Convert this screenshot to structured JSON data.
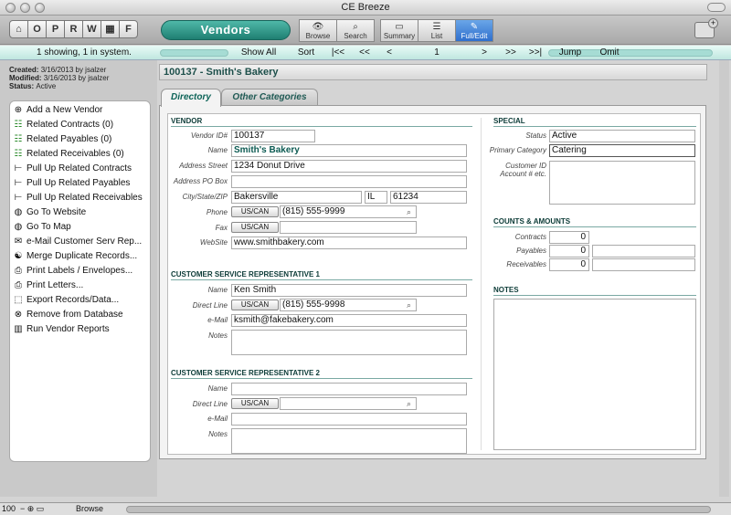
{
  "window": {
    "title": "CE Breeze"
  },
  "toolbar": {
    "home_icon": "home-icon",
    "letters": [
      "O",
      "P",
      "R",
      "W",
      "▦",
      "F"
    ],
    "module_label": "Vendors",
    "modes": [
      {
        "label": "Browse",
        "icon": "eye-icon",
        "glyph": "👁"
      },
      {
        "label": "Search",
        "icon": "magnifier-icon",
        "glyph": "⌕"
      },
      {
        "label": "Summary",
        "icon": "summary-icon",
        "glyph": "▭"
      },
      {
        "label": "List",
        "icon": "list-icon",
        "glyph": "☰"
      },
      {
        "label": "Full/Edit",
        "icon": "edit-icon",
        "glyph": "✎"
      }
    ]
  },
  "navbar": {
    "count_text": "1 showing, 1 in system.",
    "show_all": "Show All",
    "sort": "Sort",
    "first": "|<<",
    "prev_many": "<<",
    "prev": "<",
    "record_no": "1",
    "next": ">",
    "next_many": ">>",
    "last": ">>|",
    "jump": "Jump",
    "omit": "Omit"
  },
  "meta": {
    "created_label": "Created:",
    "created": "3/16/2013 by jsalzer",
    "modified_label": "Modified:",
    "modified": "3/16/2013 by jsalzer",
    "status_label": "Status:",
    "status": "Active"
  },
  "sidebar": {
    "items": [
      {
        "label": "Add a New Vendor",
        "icon": "plus-circle-icon",
        "glyph": "⊕"
      },
      {
        "label": "Related Contracts (0)",
        "icon": "list-icon",
        "glyph": "☷"
      },
      {
        "label": "Related Payables (0)",
        "icon": "list-icon",
        "glyph": "☷"
      },
      {
        "label": "Related Receivables (0)",
        "icon": "list-icon",
        "glyph": "☷"
      },
      {
        "label": "Pull Up Related Contracts",
        "icon": "tree-icon",
        "glyph": "⊢"
      },
      {
        "label": "Pull Up Related Payables",
        "icon": "tree-icon",
        "glyph": "⊢"
      },
      {
        "label": "Pull Up Related Receivables",
        "icon": "tree-icon",
        "glyph": "⊢"
      },
      {
        "label": "Go To Website",
        "icon": "globe-icon",
        "glyph": "◍"
      },
      {
        "label": "Go To Map",
        "icon": "globe-icon",
        "glyph": "◍"
      },
      {
        "label": "e-Mail Customer Serv Rep...",
        "icon": "envelope-icon",
        "glyph": "✉"
      },
      {
        "label": "Merge Duplicate Records...",
        "icon": "merge-icon",
        "glyph": "☯"
      },
      {
        "label": "Print Labels / Envelopes...",
        "icon": "printer-icon",
        "glyph": "⎙"
      },
      {
        "label": "Print Letters...",
        "icon": "printer-icon",
        "glyph": "⎙"
      },
      {
        "label": "Export Records/Data...",
        "icon": "export-icon",
        "glyph": "⬚"
      },
      {
        "label": "Remove from Database",
        "icon": "remove-icon",
        "glyph": "⊗"
      },
      {
        "label": "Run Vendor Reports",
        "icon": "chart-icon",
        "glyph": "▥"
      }
    ]
  },
  "record": {
    "header": "100137 - Smith's Bakery"
  },
  "tabs": [
    "Directory",
    "Other Categories"
  ],
  "vendor": {
    "section": "VENDOR",
    "id_label": "Vendor ID#",
    "id": "100137",
    "name_label": "Name",
    "name": "Smith's Bakery",
    "street_label": "Address Street",
    "street": "1234 Donut Drive",
    "pobox_label": "Address PO Box",
    "pobox": "",
    "csz_label": "City/State/ZIP",
    "city": "Bakersville",
    "state": "IL",
    "zip": "61234",
    "phone_label": "Phone",
    "phone_fmt": "US/CAN",
    "phone": "(815) 555-9999",
    "fax_label": "Fax",
    "fax_fmt": "US/CAN",
    "fax": "",
    "web_label": "WebSite",
    "web": "www.smithbakery.com"
  },
  "csr1": {
    "section": "CUSTOMER SERVICE REPRESENTATIVE 1",
    "name_label": "Name",
    "name": "Ken Smith",
    "direct_label": "Direct Line",
    "direct_fmt": "US/CAN",
    "direct": "(815) 555-9998",
    "email_label": "e-Mail",
    "email": "ksmith@fakebakery.com",
    "notes_label": "Notes",
    "notes": ""
  },
  "csr2": {
    "section": "CUSTOMER SERVICE REPRESENTATIVE 2",
    "name_label": "Name",
    "name": "",
    "direct_label": "Direct Line",
    "direct_fmt": "US/CAN",
    "direct": "",
    "email_label": "e-Mail",
    "email": "",
    "notes_label": "Notes",
    "notes": ""
  },
  "special": {
    "section": "SPECIAL",
    "status_label": "Status",
    "status": "Active",
    "category_label": "Primary Category",
    "category": "Catering",
    "custid_label": "Customer ID Account # etc.",
    "custid": ""
  },
  "counts": {
    "section": "COUNTS & AMOUNTS",
    "contracts_label": "Contracts",
    "contracts": "0",
    "payables_label": "Payables",
    "payables": "0",
    "receivables_label": "Receivables",
    "receivables": "0"
  },
  "notes": {
    "section": "NOTES",
    "text": ""
  },
  "statusbar": {
    "zoom": "100",
    "mode": "Browse"
  }
}
